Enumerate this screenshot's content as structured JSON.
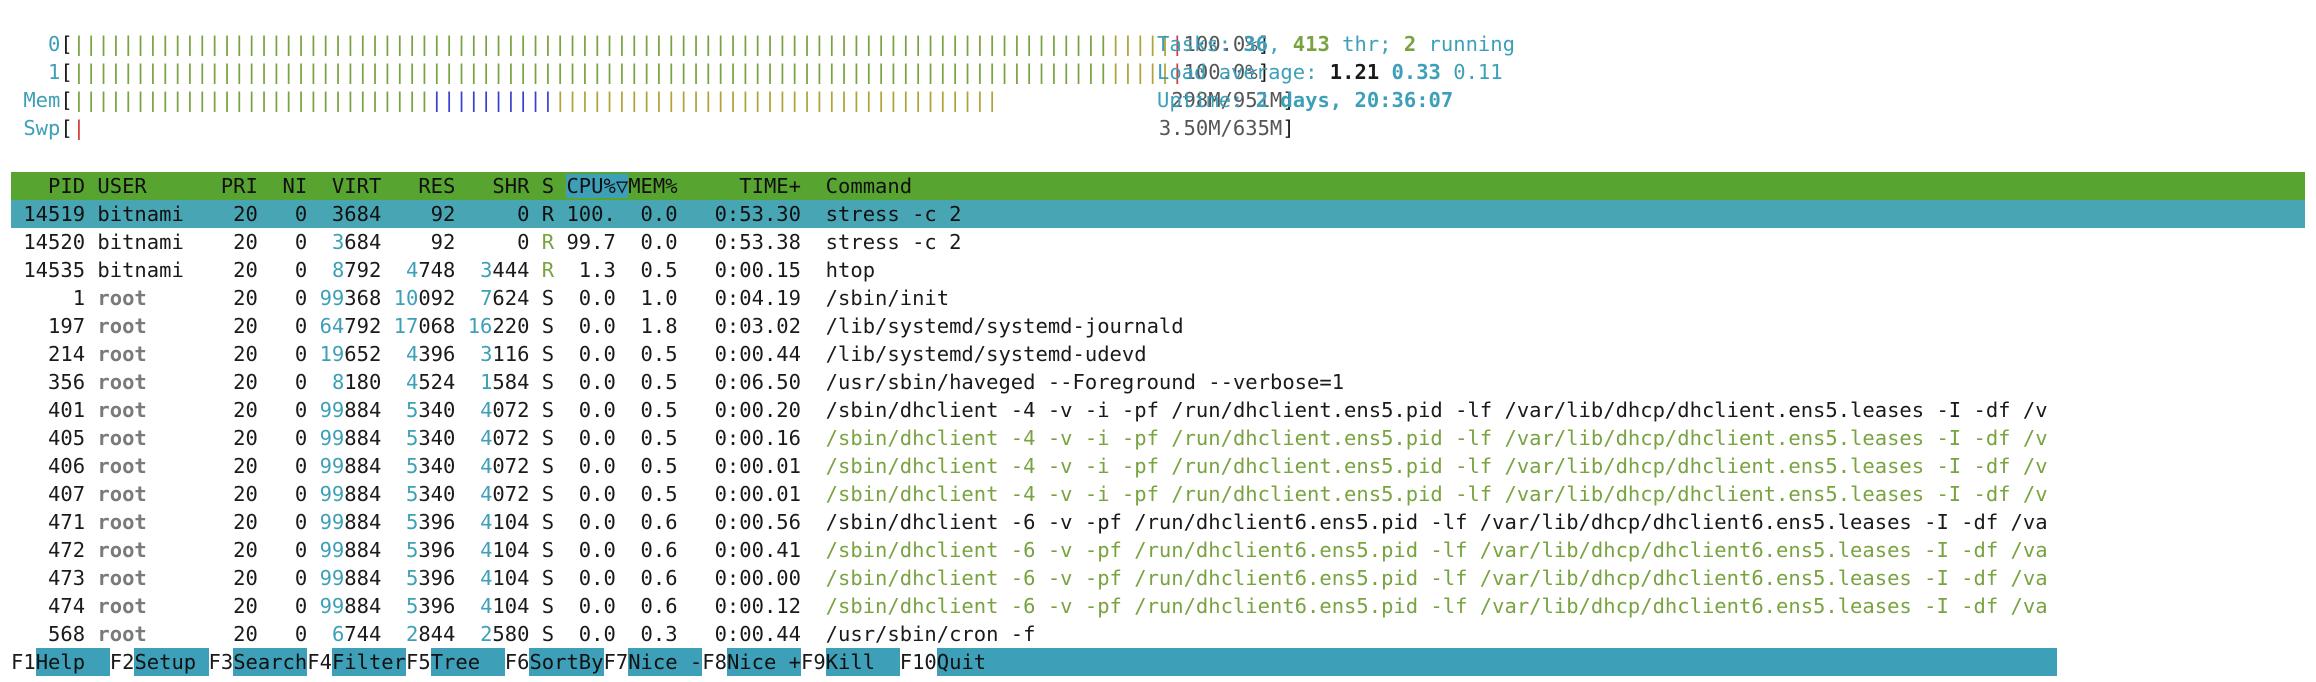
{
  "meters": {
    "cpu0": {
      "label": "0",
      "value": "100.0%"
    },
    "cpu1": {
      "label": "1",
      "value": "100.0%"
    },
    "mem": {
      "label": "Mem",
      "value": "298M/951M"
    },
    "swp": {
      "label": "Swp",
      "value": "3.50M/635M"
    }
  },
  "info": {
    "tasks_label": "Tasks: ",
    "tasks": "36",
    "sep1": ", ",
    "thr": "413",
    "thr_label": " thr; ",
    "running": "2",
    "running_label": " running",
    "load_label": "Load average: ",
    "load1": "1.21",
    "load5": "0.33",
    "load15": "0.11",
    "uptime_label": "Uptime: ",
    "uptime": "2 days, 20:36:07"
  },
  "columns": {
    "pid": "PID",
    "user": "USER",
    "pri": "PRI",
    "ni": "NI",
    "virt": "VIRT",
    "res": "RES",
    "shr": "SHR",
    "s": "S",
    "cpu": "CPU%▽",
    "mem": "MEM%",
    "time": "TIME+",
    "command": "Command"
  },
  "processes": [
    {
      "pid": "14519",
      "user": "bitnami",
      "pri": "20",
      "ni": "0",
      "virt": "3684",
      "res": "92",
      "shr": "0",
      "s": "R",
      "cpu": "100.",
      "mem": "0.0",
      "time": "0:53.30",
      "command": "stress -c 2"
    },
    {
      "pid": "14520",
      "user": "bitnami",
      "pri": "20",
      "ni": "0",
      "virt": "3684",
      "res": "92",
      "shr": "0",
      "s": "R",
      "cpu": "99.7",
      "mem": "0.0",
      "time": "0:53.38",
      "command": "stress -c 2"
    },
    {
      "pid": "14535",
      "user": "bitnami",
      "pri": "20",
      "ni": "0",
      "virt": "8792",
      "res": "4748",
      "shr": "3444",
      "s": "R",
      "cpu": "1.3",
      "mem": "0.5",
      "time": "0:00.15",
      "command": "htop"
    },
    {
      "pid": "1",
      "user": "root",
      "pri": "20",
      "ni": "0",
      "virt": "99368",
      "res": "10092",
      "shr": "7624",
      "s": "S",
      "cpu": "0.0",
      "mem": "1.0",
      "time": "0:04.19",
      "command": "/sbin/init"
    },
    {
      "pid": "197",
      "user": "root",
      "pri": "20",
      "ni": "0",
      "virt": "64792",
      "res": "17068",
      "shr": "16220",
      "s": "S",
      "cpu": "0.0",
      "mem": "1.8",
      "time": "0:03.02",
      "command": "/lib/systemd/systemd-journald"
    },
    {
      "pid": "214",
      "user": "root",
      "pri": "20",
      "ni": "0",
      "virt": "19652",
      "res": "4396",
      "shr": "3116",
      "s": "S",
      "cpu": "0.0",
      "mem": "0.5",
      "time": "0:00.44",
      "command": "/lib/systemd/systemd-udevd"
    },
    {
      "pid": "356",
      "user": "root",
      "pri": "20",
      "ni": "0",
      "virt": "8180",
      "res": "4524",
      "shr": "1584",
      "s": "S",
      "cpu": "0.0",
      "mem": "0.5",
      "time": "0:06.50",
      "command": "/usr/sbin/haveged --Foreground --verbose=1"
    },
    {
      "pid": "401",
      "user": "root",
      "pri": "20",
      "ni": "0",
      "virt": "99884",
      "res": "5340",
      "shr": "4072",
      "s": "S",
      "cpu": "0.0",
      "mem": "0.5",
      "time": "0:00.20",
      "command": "/sbin/dhclient -4 -v -i -pf /run/dhclient.ens5.pid -lf /var/lib/dhcp/dhclient.ens5.leases -I -df /v"
    },
    {
      "pid": "405",
      "user": "root",
      "pri": "20",
      "ni": "0",
      "virt": "99884",
      "res": "5340",
      "shr": "4072",
      "s": "S",
      "cpu": "0.0",
      "mem": "0.5",
      "time": "0:00.16",
      "command": "/sbin/dhclient -4 -v -i -pf /run/dhclient.ens5.pid -lf /var/lib/dhcp/dhclient.ens5.leases -I -df /v",
      "thread": true
    },
    {
      "pid": "406",
      "user": "root",
      "pri": "20",
      "ni": "0",
      "virt": "99884",
      "res": "5340",
      "shr": "4072",
      "s": "S",
      "cpu": "0.0",
      "mem": "0.5",
      "time": "0:00.01",
      "command": "/sbin/dhclient -4 -v -i -pf /run/dhclient.ens5.pid -lf /var/lib/dhcp/dhclient.ens5.leases -I -df /v",
      "thread": true
    },
    {
      "pid": "407",
      "user": "root",
      "pri": "20",
      "ni": "0",
      "virt": "99884",
      "res": "5340",
      "shr": "4072",
      "s": "S",
      "cpu": "0.0",
      "mem": "0.5",
      "time": "0:00.01",
      "command": "/sbin/dhclient -4 -v -i -pf /run/dhclient.ens5.pid -lf /var/lib/dhcp/dhclient.ens5.leases -I -df /v",
      "thread": true
    },
    {
      "pid": "471",
      "user": "root",
      "pri": "20",
      "ni": "0",
      "virt": "99884",
      "res": "5396",
      "shr": "4104",
      "s": "S",
      "cpu": "0.0",
      "mem": "0.6",
      "time": "0:00.56",
      "command": "/sbin/dhclient -6 -v -pf /run/dhclient6.ens5.pid -lf /var/lib/dhcp/dhclient6.ens5.leases -I -df /va"
    },
    {
      "pid": "472",
      "user": "root",
      "pri": "20",
      "ni": "0",
      "virt": "99884",
      "res": "5396",
      "shr": "4104",
      "s": "S",
      "cpu": "0.0",
      "mem": "0.6",
      "time": "0:00.41",
      "command": "/sbin/dhclient -6 -v -pf /run/dhclient6.ens5.pid -lf /var/lib/dhcp/dhclient6.ens5.leases -I -df /va",
      "thread": true
    },
    {
      "pid": "473",
      "user": "root",
      "pri": "20",
      "ni": "0",
      "virt": "99884",
      "res": "5396",
      "shr": "4104",
      "s": "S",
      "cpu": "0.0",
      "mem": "0.6",
      "time": "0:00.00",
      "command": "/sbin/dhclient -6 -v -pf /run/dhclient6.ens5.pid -lf /var/lib/dhcp/dhclient6.ens5.leases -I -df /va",
      "thread": true
    },
    {
      "pid": "474",
      "user": "root",
      "pri": "20",
      "ni": "0",
      "virt": "99884",
      "res": "5396",
      "shr": "4104",
      "s": "S",
      "cpu": "0.0",
      "mem": "0.6",
      "time": "0:00.12",
      "command": "/sbin/dhclient -6 -v -pf /run/dhclient6.ens5.pid -lf /var/lib/dhcp/dhclient6.ens5.leases -I -df /va",
      "thread": true
    },
    {
      "pid": "568",
      "user": "root",
      "pri": "20",
      "ni": "0",
      "virt": "6744",
      "res": "2844",
      "shr": "2580",
      "s": "S",
      "cpu": "0.0",
      "mem": "0.3",
      "time": "0:00.44",
      "command": "/usr/sbin/cron -f"
    }
  ],
  "fkeys": [
    {
      "key": "F1",
      "label": "Help  "
    },
    {
      "key": "F2",
      "label": "Setup "
    },
    {
      "key": "F3",
      "label": "Search"
    },
    {
      "key": "F4",
      "label": "Filter"
    },
    {
      "key": "F5",
      "label": "Tree  "
    },
    {
      "key": "F6",
      "label": "SortBy"
    },
    {
      "key": "F7",
      "label": "Nice -"
    },
    {
      "key": "F8",
      "label": "Nice +"
    },
    {
      "key": "F9",
      "label": "Kill  "
    },
    {
      "key": "F10",
      "label": "Quit"
    }
  ]
}
